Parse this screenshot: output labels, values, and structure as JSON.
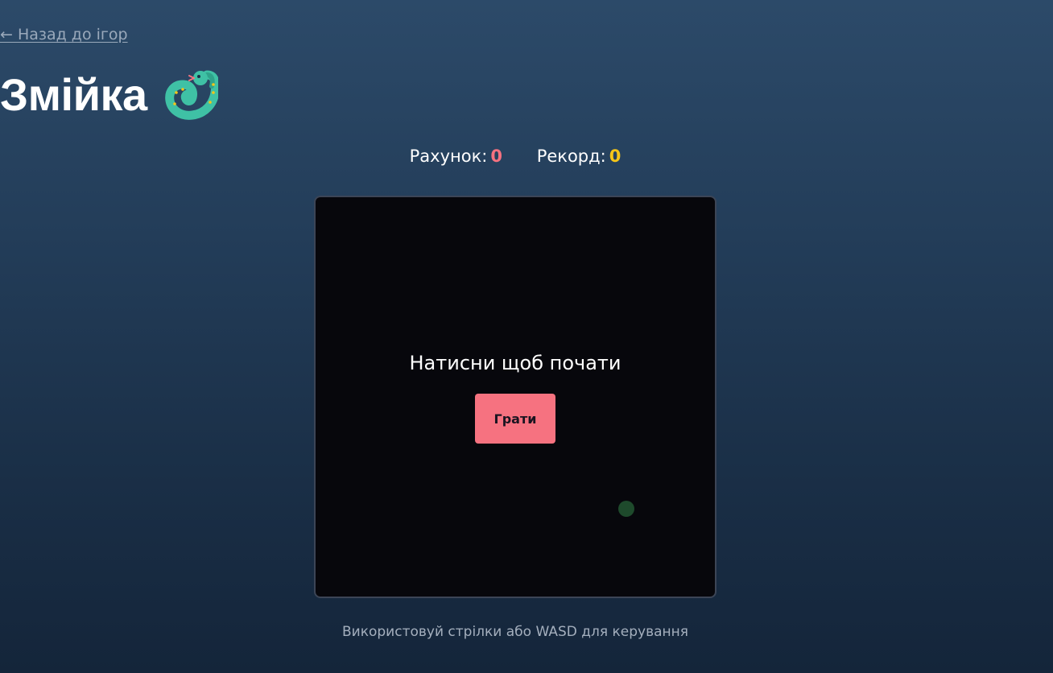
{
  "nav": {
    "back_label": "← Назад до ігор"
  },
  "header": {
    "title": "Змійка",
    "icon": "snake-icon"
  },
  "scoreboard": {
    "score_label": "Рахунок:",
    "score_value": "0",
    "record_label": "Рекорд:",
    "record_value": "0"
  },
  "game": {
    "start_prompt": "Натисни щоб почати",
    "play_label": "Грати",
    "food_color": "#1e4a2c"
  },
  "footer": {
    "controls_hint": "Використовуй стрілки або WASD для керування"
  },
  "colors": {
    "accent": "#f67280",
    "record": "#f5c518",
    "board_bg": "#07070c"
  }
}
